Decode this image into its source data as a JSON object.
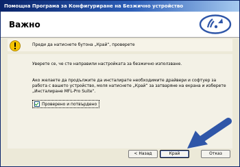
{
  "window": {
    "title": "Помощна Програма за Конфигуриране на Безжично устройство"
  },
  "header": {
    "title": "Важно"
  },
  "warning": {
    "text": "Преди да натиснете бутона „Край“, проверете",
    "icon": "warning-icon",
    "icon_color": "#f5c400"
  },
  "body": {
    "paragraph1": "Уверете се, че сте направили настройката за безжично използване.",
    "paragraph2_lines": [
      "Ако желаете да продължите да инсталирате необходимите драйвери и софтуер за",
      "работа с вашето устройство, моля натиснете „Край“ за затваряне на екрана и изберете",
      "„Инсталиране MFL-Pro Suite“."
    ]
  },
  "checkbox": {
    "label": "Проверено и потвърдено",
    "checked": true
  },
  "buttons": {
    "back": "< Назад",
    "finish": "Край",
    "cancel": "Отказ"
  },
  "colors": {
    "arrow": "#2f56a8",
    "logo": "#2f56a8",
    "titlebar": "#0a246a"
  }
}
